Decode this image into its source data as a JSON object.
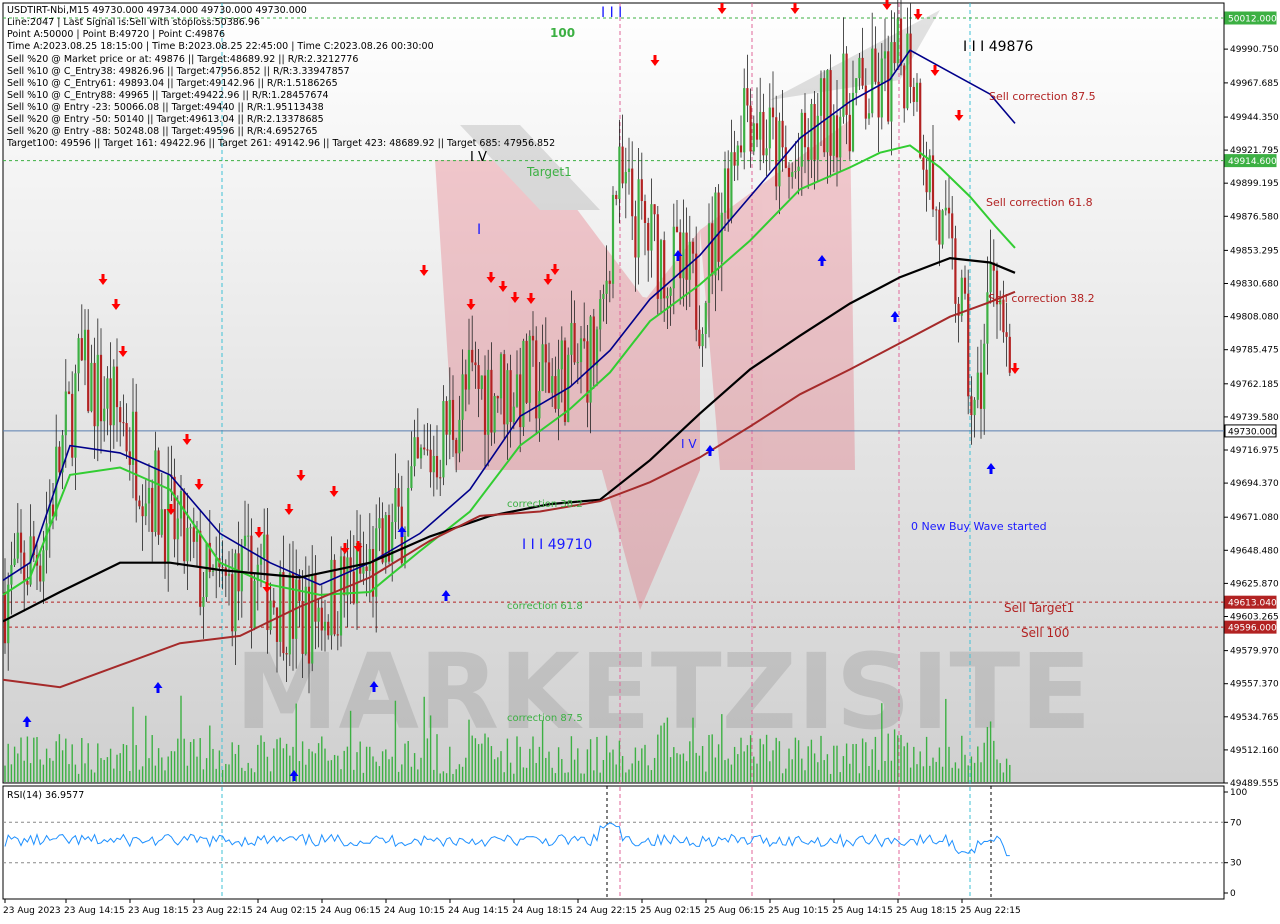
{
  "header": {
    "title": "USDTIRT-Nbi,M15  49730.000 49734.000 49730.000 49730.000",
    "lines": [
      "Line:2047 | Last Signal is:Sell with stoploss:50386.96",
      "Point A:50000 | Point B:49720 | Point C:49876",
      "Time A:2023.08.25 18:15:00 | Time B:2023.08.25 22:45:00 | Time C:2023.08.26 00:30:00",
      "Sell %20 @ Market price or at: 49876 || Target:48689.92 || R/R:2.3212776",
      "Sell %10 @ C_Entry38: 49826.96 || Target:47956.852 || R/R:3.33947857",
      "Sell %10 @ C_Entry61: 49893.04 || Target:49142.96 || R/R:1.5186265",
      "Sell %10 @ C_Entry88: 49965 || Target:49422.96 || R/R:1.28457674",
      "Sell %10 @ Entry -23: 50066.08 || Target:49440 || R/R:1.95113438",
      "Sell %20 @ Entry -50: 50140 || Target:49613.04 || R/R:2.13378685",
      "Sell %20 @ Entry -88: 50248.08 || Target:49596 || R/R:4.6952765",
      "Target100: 49596 || Target 161: 49422.96 || Target 261: 49142.96 || Target 423: 48689.92 || Target 685: 47956.852"
    ]
  },
  "price_axis": {
    "ticks": [
      "49990.750",
      "49967.685",
      "49944.350",
      "49921.795",
      "49899.195",
      "49876.580",
      "49853.295",
      "49830.680",
      "49808.080",
      "49785.475",
      "49762.185",
      "49739.580",
      "49716.975",
      "49694.370",
      "49671.080",
      "49648.480",
      "49625.870",
      "49603.265",
      "49579.970",
      "49557.370",
      "49534.765",
      "49512.160",
      "49489.555"
    ],
    "badges": [
      {
        "text": "50012.000",
        "color": "#3cb043"
      },
      {
        "text": "49914.600",
        "color": "#3cb043"
      },
      {
        "text": "49730.000",
        "color": "#ffffff"
      },
      {
        "text": "49613.040",
        "color": "#b22222"
      },
      {
        "text": "49596.000",
        "color": "#b22222"
      }
    ]
  },
  "time_axis": [
    "23 Aug 2023",
    "23 Aug 14:15",
    "23 Aug 18:15",
    "23 Aug 22:15",
    "24 Aug 02:15",
    "24 Aug 06:15",
    "24 Aug 10:15",
    "24 Aug 14:15",
    "24 Aug 18:15",
    "24 Aug 22:15",
    "25 Aug 02:15",
    "25 Aug 06:15",
    "25 Aug 10:15",
    "25 Aug 14:15",
    "25 Aug 18:15",
    "25 Aug 22:15"
  ],
  "labels": {
    "l100": "100",
    "target1": "Target1",
    "c875": "Sell correction 87.5",
    "c618": "Sell correction 61.8",
    "c382": "Sell correction 38.2",
    "corr382": "correction 38.2",
    "corr618": "correction 61.8",
    "corr875": "correction 87.5",
    "wave_top": "I I I 49876",
    "wave_low": "I I I 49710",
    "wave_i": "I",
    "wave_iv": "I V",
    "wave_iii_top": "I I I",
    "wave_iv2": "I V",
    "new_buy": "0 New Buy Wave started",
    "sell_target1": "Sell Target1",
    "sell100": "Sell 100",
    "watermark": "MARKETZISITE"
  },
  "rsi": {
    "title": "RSI(14) 36.9577",
    "levels": [
      "100",
      "70",
      "30",
      "0"
    ]
  },
  "colors": {
    "candle_up": "#3cb043",
    "candle_down": "#b22222",
    "ma_blue": "#00008b",
    "ma_green": "#32cd32",
    "ma_black": "#000000",
    "ma_red": "#a52a2a",
    "rsi_line": "#1e90ff",
    "sell_arrow": "#ff0000",
    "buy_arrow": "#0000ff"
  },
  "chart_data": {
    "type": "candlestick",
    "title": "USDTIRT-Nbi,M15",
    "ylim": [
      49489.555,
      50012.0
    ],
    "last_price": 49730.0,
    "levels": {
      "target_line": 50012.0,
      "target1": 49914.6,
      "sell_target1": 49613.04,
      "sell100": 49596.0,
      "last": 49730.0
    },
    "series": [
      {
        "x": [
          "23 Aug 2023",
          "23 Aug 14:15",
          "23 Aug 18:15",
          "23 Aug 22:15",
          "24 Aug 02:15",
          "24 Aug 06:15",
          "24 Aug 10:15",
          "24 Aug 14:15",
          "24 Aug 18:15",
          "24 Aug 22:15",
          "25 Aug 02:15",
          "25 Aug 06:15",
          "25 Aug 10:15",
          "25 Aug 14:15",
          "25 Aug 18:15",
          "25 Aug 22:15"
        ],
        "values": [
          49620,
          49770,
          49700,
          49620,
          49600,
          49640,
          49720,
          49760,
          49770,
          49850,
          49860,
          49910,
          49920,
          49950,
          49960,
          49760
        ]
      }
    ],
    "rsi": {
      "value": 36.9577,
      "ylim": [
        0,
        100
      ],
      "levels": [
        70,
        30
      ]
    }
  }
}
